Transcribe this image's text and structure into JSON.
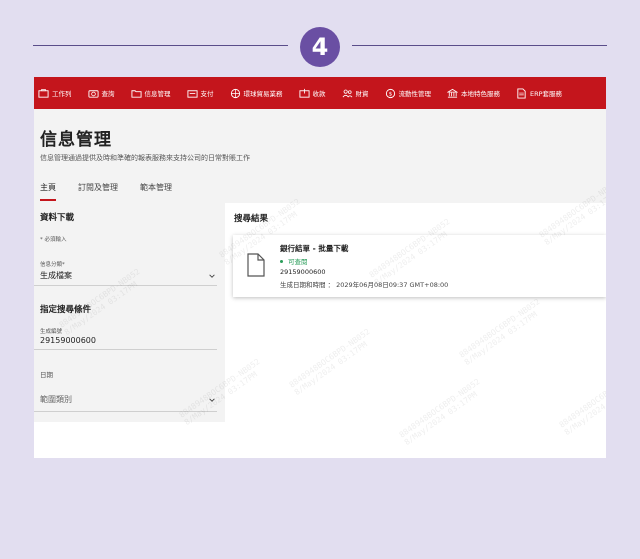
{
  "step": {
    "number": "4"
  },
  "nav": {
    "items": [
      {
        "icon": "briefcase-icon",
        "label": "工作列"
      },
      {
        "icon": "camera-icon",
        "label": "查詢"
      },
      {
        "icon": "folder-icon",
        "label": "信息管理"
      },
      {
        "icon": "transfer-icon",
        "label": "支付"
      },
      {
        "icon": "globe-icon",
        "label": "環球貿易業務"
      },
      {
        "icon": "inbox-icon",
        "label": "收款"
      },
      {
        "icon": "users-icon",
        "label": "財資"
      },
      {
        "icon": "dollar-icon",
        "label": "流動性管理"
      },
      {
        "icon": "bank-icon",
        "label": "本地特色服務"
      },
      {
        "icon": "document-icon",
        "label": "ERP套服務"
      }
    ]
  },
  "page": {
    "title": "信息管理",
    "description": "信息管理通過提供及時和準確的報表服務來支持公司的日常對賬工作"
  },
  "tabs": [
    {
      "label": "主頁",
      "active": true
    },
    {
      "label": "訂閱及管理",
      "active": false
    },
    {
      "label": "範本管理",
      "active": false
    }
  ],
  "download": {
    "title": "資料下載",
    "required_note": "* 必須輸入",
    "category_label": "信息分類*",
    "category_value": "生成檔案"
  },
  "criteria": {
    "title": "指定搜尋條件",
    "id_label": "生成編號",
    "id_value": "29159000600",
    "date_label": "日期",
    "range_placeholder": "範圍類別"
  },
  "results": {
    "title": "搜尋結果",
    "item": {
      "title": "銀行結單 - 批量下載",
      "status": "可查閱",
      "id": "29159000600",
      "date": "生成日期和時間 ： 2029年06月08日09:37 GMT+08:00"
    }
  },
  "watermark": {
    "line1": "8848948BOC6BPD-NB052",
    "line2": "8/May/2024 03:17PM"
  },
  "colors": {
    "background": "#e2def0",
    "accent_purple": "#6a4fa3",
    "brand_red": "#c4151c",
    "status_green": "#2a9d5a"
  }
}
